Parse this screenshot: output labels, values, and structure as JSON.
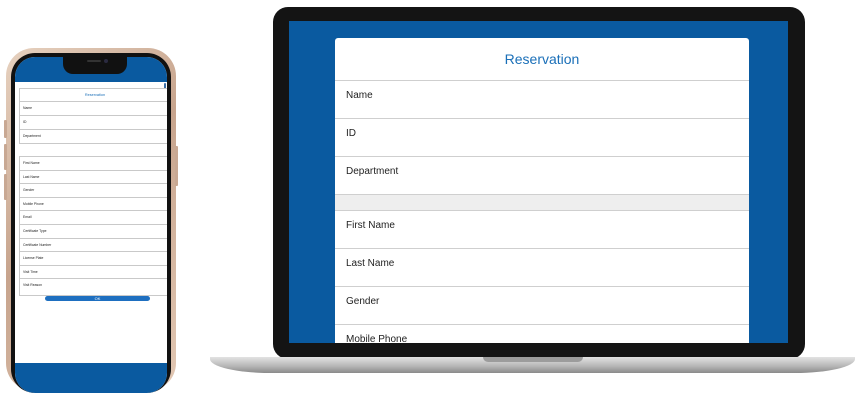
{
  "phone": {
    "form": {
      "title": "Reservation",
      "top_fields": [
        "Name",
        "ID",
        "Department"
      ],
      "bottom_fields": [
        "First Name",
        "Last Name",
        "Gender",
        "Mobile Phone",
        "Email",
        "Certificate Type",
        "Certificate Number",
        "License Plate",
        "Visit Time",
        "Visit Reason"
      ],
      "ok_label": "OK"
    }
  },
  "laptop": {
    "form": {
      "title": "Reservation",
      "top_fields": [
        "Name",
        "ID",
        "Department"
      ],
      "bottom_fields": [
        "First Name",
        "Last Name",
        "Gender",
        "Mobile Phone"
      ]
    }
  },
  "colors": {
    "accent": "#0a5aa0",
    "title_text": "#1a6fb8",
    "button": "#1e6fc0"
  }
}
